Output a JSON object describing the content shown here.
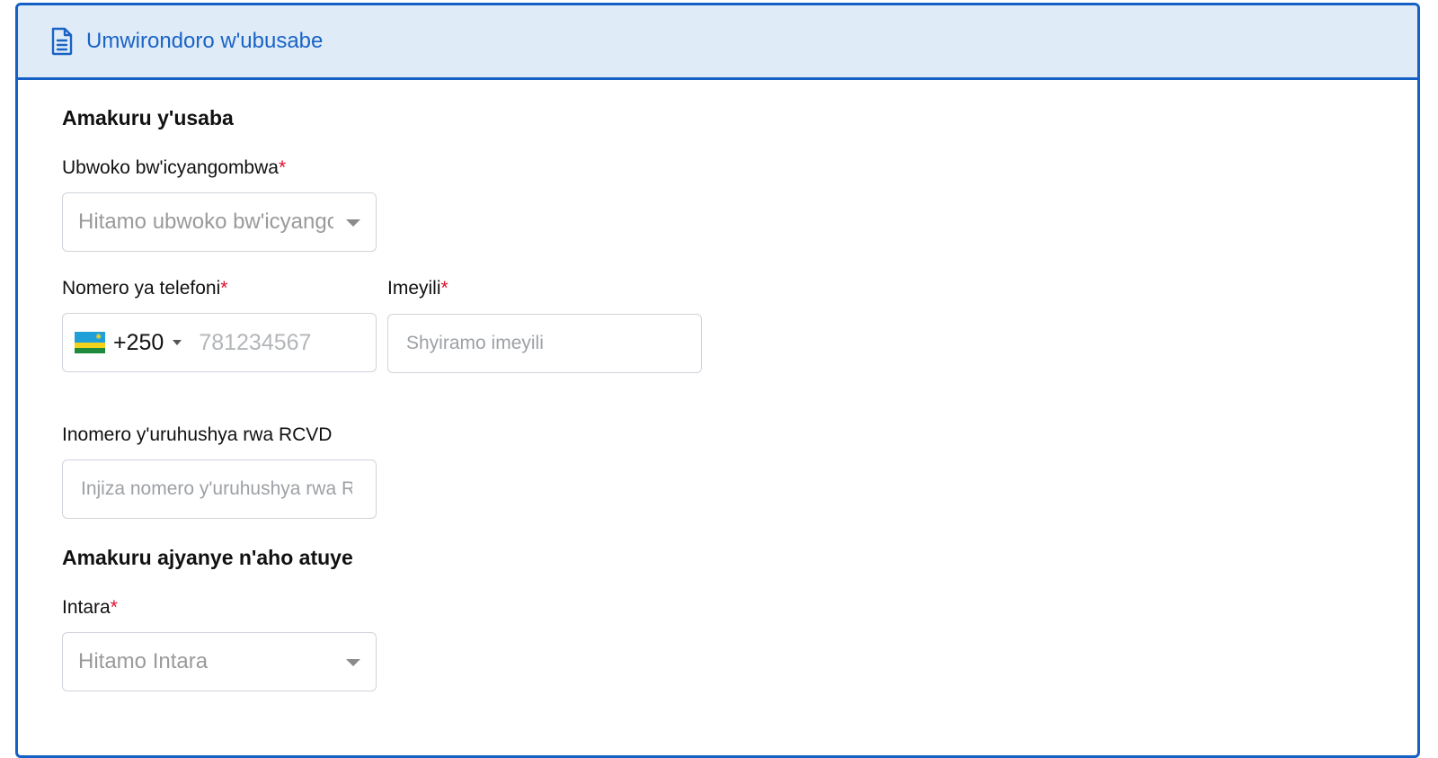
{
  "header": {
    "icon": "document-icon",
    "title": "Umwirondoro w'ubusabe"
  },
  "applicant_section": {
    "title": "Amakuru y'usaba",
    "document_type": {
      "label": "Ubwoko bw'icyangombwa",
      "required_mark": "*",
      "placeholder": "Hitamo ubwoko bw'icyangombwa"
    },
    "phone": {
      "label": "Nomero ya telefoni",
      "required_mark": "*",
      "country_flag": "rwanda-flag-icon",
      "dial_code": "+250",
      "placeholder": "781234567"
    },
    "email": {
      "label": "Imeyili",
      "required_mark": "*",
      "placeholder": "Shyiramo imeyili"
    },
    "rcvd_license": {
      "label": "Inomero y'uruhushya rwa RCVD",
      "placeholder": "Injiza nomero y'uruhushya rwa RCVD"
    }
  },
  "residence_section": {
    "title": "Amakuru ajyanye n'aho atuye",
    "province": {
      "label": "Intara",
      "required_mark": "*",
      "placeholder": "Hitamo Intara"
    }
  },
  "colors": {
    "accent": "#1560c4",
    "header_bg": "#dfecf7",
    "required": "#e0102a"
  }
}
